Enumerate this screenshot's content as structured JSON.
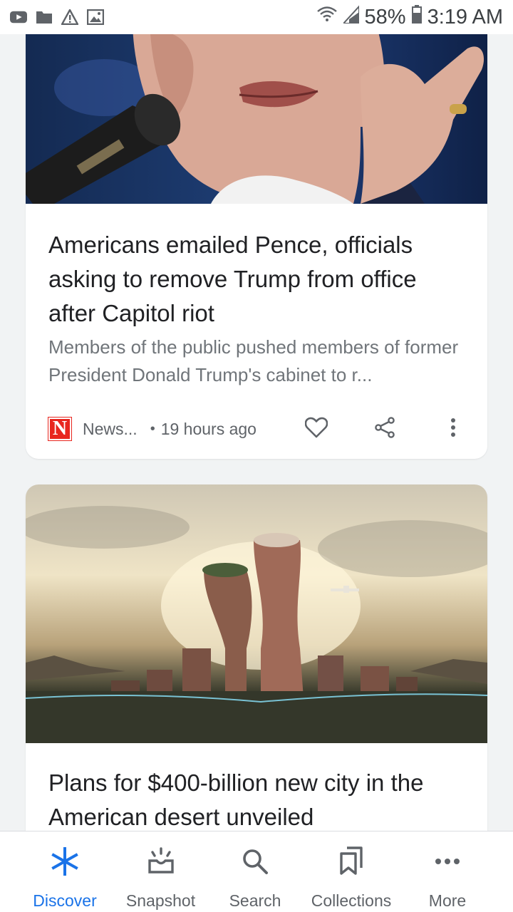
{
  "status_bar": {
    "battery": "58%",
    "time": "3:19 AM",
    "left_icons": [
      "youtube-icon",
      "folder-icon",
      "warning-icon",
      "image-icon"
    ],
    "right_icons": [
      "wifi-icon",
      "signal-icon",
      "battery-icon"
    ]
  },
  "feed": {
    "cards": [
      {
        "headline": "Americans emailed Pence, officials asking to remove Trump from office after Capitol riot",
        "snippet": "Members of the public pushed members of former President Donald Trump's cabinet to r...",
        "source_logo": "N",
        "source": "News...",
        "separator": "•",
        "time": "19 hours ago"
      },
      {
        "headline": "Plans for $400-billion new city in the American desert unveiled"
      }
    ]
  },
  "bottom_nav": {
    "items": [
      {
        "label": "Discover",
        "icon": "asterisk-icon",
        "active": true
      },
      {
        "label": "Snapshot",
        "icon": "snapshot-icon",
        "active": false
      },
      {
        "label": "Search",
        "icon": "search-icon",
        "active": false
      },
      {
        "label": "Collections",
        "icon": "collections-icon",
        "active": false
      },
      {
        "label": "More",
        "icon": "more-horiz-icon",
        "active": false
      }
    ]
  },
  "colors": {
    "accent": "#1a73e8",
    "source_brand": "#e8261f",
    "secondary_text": "#5f6368"
  }
}
